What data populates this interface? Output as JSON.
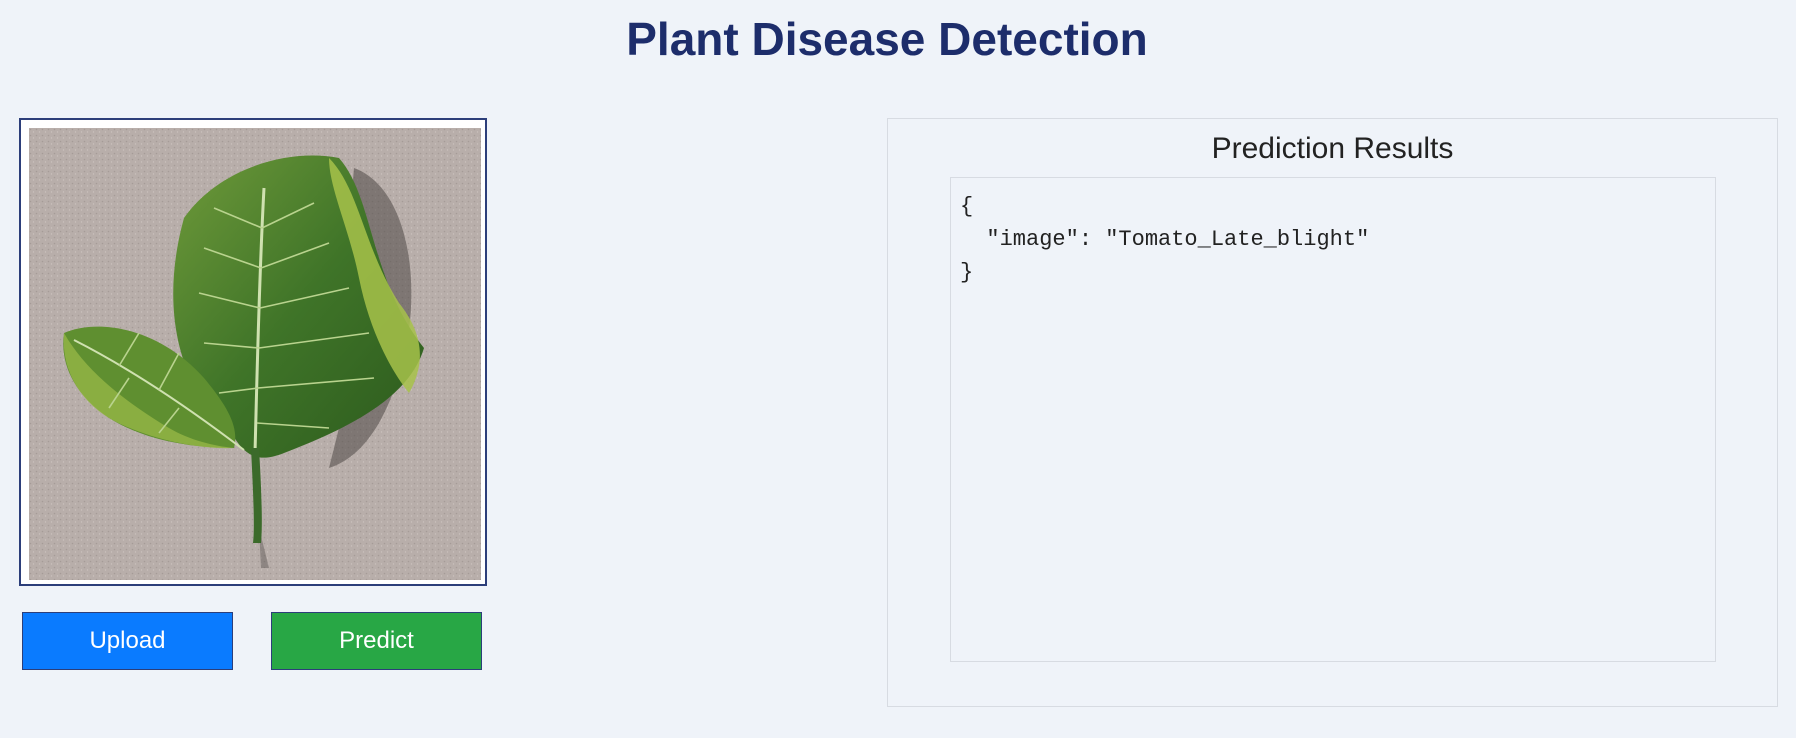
{
  "page": {
    "title": "Plant Disease Detection"
  },
  "image_preview": {
    "content": "tomato leaf photo on gray textured surface"
  },
  "buttons": {
    "upload_label": "Upload",
    "predict_label": "Predict"
  },
  "results": {
    "title": "Prediction Results",
    "output": "{\n  \"image\": \"Tomato_Late_blight\"\n}"
  },
  "colors": {
    "title": "#1d2d6b",
    "upload_button": "#0a7bff",
    "predict_button": "#28a745",
    "background": "#eff3f9"
  }
}
